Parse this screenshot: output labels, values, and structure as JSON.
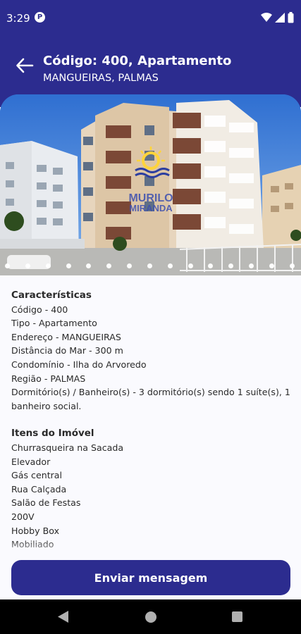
{
  "status_bar": {
    "time": "3:29",
    "badge_letter": "P"
  },
  "header": {
    "title": "Código: 400, Apartamento",
    "subtitle": "MANGUEIRAS, PALMAS"
  },
  "gallery": {
    "watermark_top": "MURILO",
    "watermark_bottom": "MIRANDA",
    "photo_count": 15
  },
  "characteristics": {
    "heading": "Características",
    "lines": [
      "Código - 400",
      "Tipo - Apartamento",
      "Endereço - MANGUEIRAS",
      "Distância do Mar - 300 m",
      "Condomínio - Ilha do Arvoredo",
      "Região - PALMAS",
      "Dormitório(s) / Banheiro(s) - 3 dormitório(s) sendo 1 suíte(s), 1 banheiro social."
    ]
  },
  "features": {
    "heading": "Itens do Imóvel",
    "items": [
      "Churrasqueira na Sacada",
      "Elevador",
      "Gás central",
      "Rua Calçada",
      "Salão de Festas",
      "200V",
      "Hobby Box",
      "Mobiliado"
    ]
  },
  "actions": {
    "send_label": "Enviar mensagem"
  },
  "colors": {
    "primary": "#2c2c8f",
    "background": "#fafafe"
  }
}
